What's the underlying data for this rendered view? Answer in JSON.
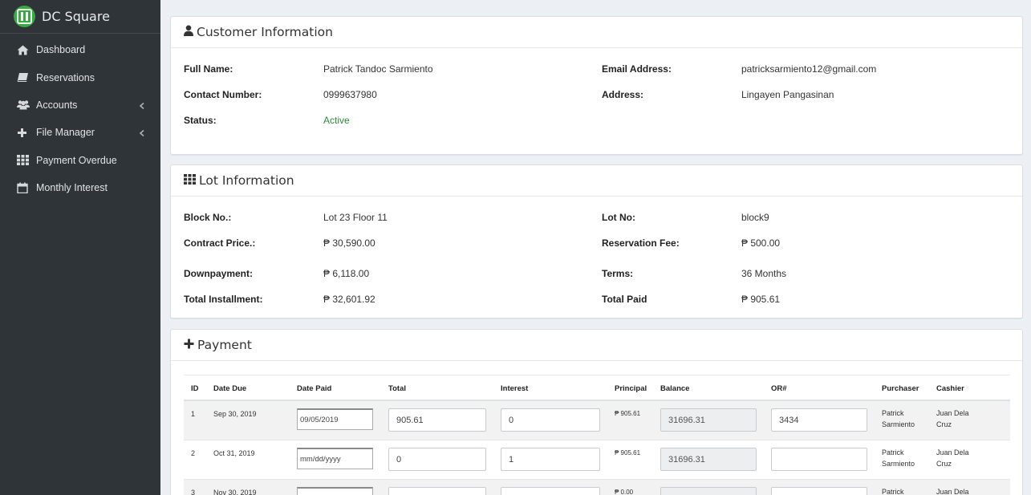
{
  "brand": {
    "name": "DC Square"
  },
  "sidebar": {
    "items": [
      {
        "label": "Dashboard",
        "icon": "home-icon",
        "has_chevron": false
      },
      {
        "label": "Reservations",
        "icon": "book-icon",
        "has_chevron": false
      },
      {
        "label": "Accounts",
        "icon": "users-icon",
        "has_chevron": true
      },
      {
        "label": "File Manager",
        "icon": "plus-icon",
        "has_chevron": true
      },
      {
        "label": "Payment Overdue",
        "icon": "grid-icon",
        "has_chevron": false
      },
      {
        "label": "Monthly Interest",
        "icon": "calendar-icon",
        "has_chevron": false
      }
    ]
  },
  "customer": {
    "title": "Customer Information",
    "full_name_label": "Full Name:",
    "full_name": "Patrick Tandoc Sarmiento",
    "email_label": "Email Address:",
    "email": "patricksarmiento12@gmail.com",
    "contact_label": "Contact Number:",
    "contact": "0999637980",
    "address_label": "Address:",
    "address": "Lingayen Pangasinan",
    "status_label": "Status:",
    "status": "Active"
  },
  "lot": {
    "title": "Lot Information",
    "block_label": "Block No.:",
    "block": "Lot 23 Floor 11",
    "lot_no_label": "Lot No:",
    "lot_no": "block9",
    "contract_label": "Contract Price.:",
    "contract": "₱ 30,590.00",
    "reservation_label": "Reservation Fee:",
    "reservation": "₱ 500.00",
    "downpayment_label": "Downpayment:",
    "downpayment": "₱ 6,118.00",
    "terms_label": "Terms:",
    "terms": "36 Months",
    "total_installment_label": "Total Installment:",
    "total_installment": "₱ 32,601.92",
    "total_paid_label": "Total Paid",
    "total_paid": "₱ 905.61"
  },
  "payment": {
    "title": "Payment",
    "columns": [
      "ID",
      "Date Due",
      "Date Paid",
      "Total",
      "Interest",
      "Principal",
      "Balance",
      "OR#",
      "Purchaser",
      "Cashier"
    ],
    "rows": [
      {
        "id": "1",
        "date_due": "Sep 30, 2019",
        "date_paid": "09/05/2019",
        "total": "905.61",
        "interest": "0",
        "principal": "₱ 905.61",
        "balance": "31696.31",
        "or": "3434",
        "purchaser": "Patrick Sarmiento",
        "cashier": "Juan Dela Cruz"
      },
      {
        "id": "2",
        "date_due": "Oct 31, 2019",
        "date_paid": "mm/dd/yyyy",
        "total": "0",
        "interest": "1",
        "principal": "₱ 905.61",
        "balance": "31696.31",
        "or": "",
        "purchaser": "Patrick Sarmiento",
        "cashier": "Juan Dela Cruz"
      },
      {
        "id": "3",
        "date_due": "Nov 30, 2019",
        "date_paid": "",
        "total": "",
        "interest": "",
        "principal": "₱ 0.00",
        "balance": "",
        "or": "",
        "purchaser": "Patrick",
        "cashier": "Juan Dela"
      }
    ]
  }
}
